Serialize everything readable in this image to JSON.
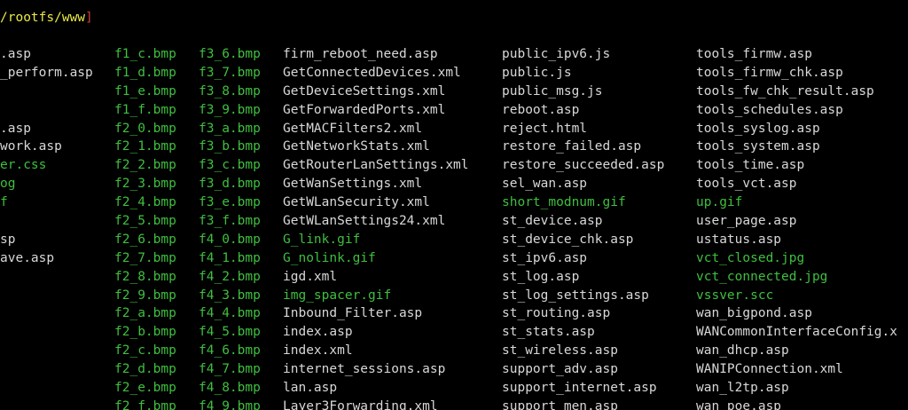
{
  "prompt": {
    "path": "/rootfs/www",
    "bracket": "]"
  },
  "colors": {
    "background": "#000000",
    "default_text": "#d8d8d8",
    "highlight_text": "#3fbf3f",
    "prompt_path": "#e8e84a",
    "prompt_bracket": "#d23c3c"
  },
  "listing": [
    [
      {
        "t": ".asp",
        "c": "default"
      },
      {
        "t": "_perform.asp",
        "c": "default"
      },
      {
        "t": "",
        "c": "spacer"
      },
      {
        "t": "",
        "c": "spacer"
      },
      {
        "t": ".asp",
        "c": "default"
      },
      {
        "t": "work.asp",
        "c": "default"
      },
      {
        "t": "er.css",
        "c": "green"
      },
      {
        "t": "og",
        "c": "green"
      },
      {
        "t": "f",
        "c": "green"
      },
      {
        "t": "",
        "c": "spacer"
      },
      {
        "t": "sp",
        "c": "default"
      },
      {
        "t": "ave.asp",
        "c": "default"
      }
    ],
    [
      {
        "t": "f1_c.bmp",
        "c": "green"
      },
      {
        "t": "f1_d.bmp",
        "c": "green"
      },
      {
        "t": "f1_e.bmp",
        "c": "green"
      },
      {
        "t": "f1_f.bmp",
        "c": "green"
      },
      {
        "t": "f2_0.bmp",
        "c": "green"
      },
      {
        "t": "f2_1.bmp",
        "c": "green"
      },
      {
        "t": "f2_2.bmp",
        "c": "green"
      },
      {
        "t": "f2_3.bmp",
        "c": "green"
      },
      {
        "t": "f2_4.bmp",
        "c": "green"
      },
      {
        "t": "f2_5.bmp",
        "c": "green"
      },
      {
        "t": "f2_6.bmp",
        "c": "green"
      },
      {
        "t": "f2_7.bmp",
        "c": "green"
      },
      {
        "t": "f2_8.bmp",
        "c": "green"
      },
      {
        "t": "f2_9.bmp",
        "c": "green"
      },
      {
        "t": "f2_a.bmp",
        "c": "green"
      },
      {
        "t": "f2_b.bmp",
        "c": "green"
      },
      {
        "t": "f2_c.bmp",
        "c": "green"
      },
      {
        "t": "f2_d.bmp",
        "c": "green"
      },
      {
        "t": "f2_e.bmp",
        "c": "green"
      },
      {
        "t": "f2_f.bmp",
        "c": "green"
      }
    ],
    [
      {
        "t": "f3_6.bmp",
        "c": "green"
      },
      {
        "t": "f3_7.bmp",
        "c": "green"
      },
      {
        "t": "f3_8.bmp",
        "c": "green"
      },
      {
        "t": "f3_9.bmp",
        "c": "green"
      },
      {
        "t": "f3_a.bmp",
        "c": "green"
      },
      {
        "t": "f3_b.bmp",
        "c": "green"
      },
      {
        "t": "f3_c.bmp",
        "c": "green"
      },
      {
        "t": "f3_d.bmp",
        "c": "green"
      },
      {
        "t": "f3_e.bmp",
        "c": "green"
      },
      {
        "t": "f3_f.bmp",
        "c": "green"
      },
      {
        "t": "f4_0.bmp",
        "c": "green"
      },
      {
        "t": "f4_1.bmp",
        "c": "green"
      },
      {
        "t": "f4_2.bmp",
        "c": "green"
      },
      {
        "t": "f4_3.bmp",
        "c": "green"
      },
      {
        "t": "f4_4.bmp",
        "c": "green"
      },
      {
        "t": "f4_5.bmp",
        "c": "green"
      },
      {
        "t": "f4_6.bmp",
        "c": "green"
      },
      {
        "t": "f4_7.bmp",
        "c": "green"
      },
      {
        "t": "f4_8.bmp",
        "c": "green"
      },
      {
        "t": "f4_9.bmp",
        "c": "green"
      }
    ],
    [
      {
        "t": "firm_reboot_need.asp",
        "c": "default"
      },
      {
        "t": "GetConnectedDevices.xml",
        "c": "default"
      },
      {
        "t": "GetDeviceSettings.xml",
        "c": "default"
      },
      {
        "t": "GetForwardedPorts.xml",
        "c": "default"
      },
      {
        "t": "GetMACFilters2.xml",
        "c": "default"
      },
      {
        "t": "GetNetworkStats.xml",
        "c": "default"
      },
      {
        "t": "GetRouterLanSettings.xml",
        "c": "default"
      },
      {
        "t": "GetWanSettings.xml",
        "c": "default"
      },
      {
        "t": "GetWLanSecurity.xml",
        "c": "default"
      },
      {
        "t": "GetWLanSettings24.xml",
        "c": "default"
      },
      {
        "t": "G_link.gif",
        "c": "green"
      },
      {
        "t": "G_nolink.gif",
        "c": "green"
      },
      {
        "t": "igd.xml",
        "c": "default"
      },
      {
        "t": "img_spacer.gif",
        "c": "green"
      },
      {
        "t": "Inbound_Filter.asp",
        "c": "default"
      },
      {
        "t": "index.asp",
        "c": "default"
      },
      {
        "t": "index.xml",
        "c": "default"
      },
      {
        "t": "internet_sessions.asp",
        "c": "default"
      },
      {
        "t": "lan.asp",
        "c": "default"
      },
      {
        "t": "Layer3Forwarding.xml",
        "c": "default"
      }
    ],
    [
      {
        "t": "public_ipv6.js",
        "c": "default"
      },
      {
        "t": "public.js",
        "c": "default"
      },
      {
        "t": "public_msg.js",
        "c": "default"
      },
      {
        "t": "reboot.asp",
        "c": "default"
      },
      {
        "t": "reject.html",
        "c": "default"
      },
      {
        "t": "restore_failed.asp",
        "c": "default"
      },
      {
        "t": "restore_succeeded.asp",
        "c": "default"
      },
      {
        "t": "sel_wan.asp",
        "c": "default"
      },
      {
        "t": "short_modnum.gif",
        "c": "green"
      },
      {
        "t": "st_device.asp",
        "c": "default"
      },
      {
        "t": "st_device_chk.asp",
        "c": "default"
      },
      {
        "t": "st_ipv6.asp",
        "c": "default"
      },
      {
        "t": "st_log.asp",
        "c": "default"
      },
      {
        "t": "st_log_settings.asp",
        "c": "default"
      },
      {
        "t": "st_routing.asp",
        "c": "default"
      },
      {
        "t": "st_stats.asp",
        "c": "default"
      },
      {
        "t": "st_wireless.asp",
        "c": "default"
      },
      {
        "t": "support_adv.asp",
        "c": "default"
      },
      {
        "t": "support_internet.asp",
        "c": "default"
      },
      {
        "t": "support_men.asp",
        "c": "default"
      }
    ],
    [
      {
        "t": "tools_firmw.asp",
        "c": "default"
      },
      {
        "t": "tools_firmw_chk.asp",
        "c": "default"
      },
      {
        "t": "tools_fw_chk_result.asp",
        "c": "default"
      },
      {
        "t": "tools_schedules.asp",
        "c": "default"
      },
      {
        "t": "tools_syslog.asp",
        "c": "default"
      },
      {
        "t": "tools_system.asp",
        "c": "default"
      },
      {
        "t": "tools_time.asp",
        "c": "default"
      },
      {
        "t": "tools_vct.asp",
        "c": "default"
      },
      {
        "t": "up.gif",
        "c": "green"
      },
      {
        "t": "user_page.asp",
        "c": "default"
      },
      {
        "t": "ustatus.asp",
        "c": "default"
      },
      {
        "t": "vct_closed.jpg",
        "c": "green"
      },
      {
        "t": "vct_connected.jpg",
        "c": "green"
      },
      {
        "t": "vssver.scc",
        "c": "green"
      },
      {
        "t": "wan_bigpond.asp",
        "c": "default"
      },
      {
        "t": "WANCommonInterfaceConfig.x",
        "c": "default"
      },
      {
        "t": "wan_dhcp.asp",
        "c": "default"
      },
      {
        "t": "WANIPConnection.xml",
        "c": "default"
      },
      {
        "t": "wan_l2tp.asp",
        "c": "default"
      },
      {
        "t": "wan_poe.asp",
        "c": "default"
      }
    ]
  ]
}
